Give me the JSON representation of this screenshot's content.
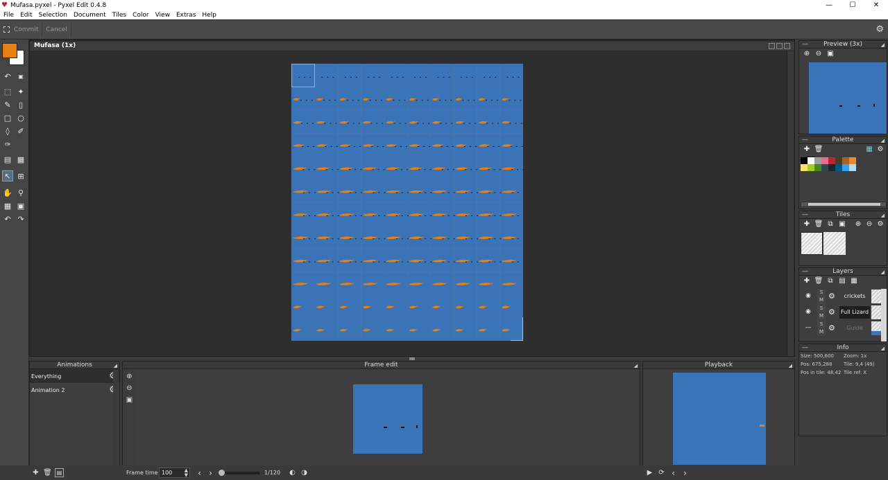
{
  "window": {
    "title": "Mufasa.pyxel - Pyxel Edit 0.4.8",
    "controls": {
      "minimize": "—",
      "maximize": "☐",
      "close": "✕"
    }
  },
  "menu": [
    "File",
    "Edit",
    "Selection",
    "Document",
    "Tiles",
    "Color",
    "View",
    "Extras",
    "Help"
  ],
  "toolbar": {
    "commit_label": "Commit",
    "cancel_label": "Cancel"
  },
  "colors": {
    "primary": "#e87f10",
    "secondary": "#ffffff",
    "canvas_bg": "#3a73b6"
  },
  "canvas": {
    "title": "Mufasa  (1x)"
  },
  "animations": {
    "title": "Animations",
    "items": [
      {
        "label": "Everything",
        "selected": true
      },
      {
        "label": "Animation 2",
        "selected": false
      }
    ]
  },
  "frame_edit": {
    "title": "Frame edit",
    "frame_time_label": "Frame time",
    "frame_time_value": "100",
    "frame_counter": "1/120",
    "frame_position": 0.0
  },
  "playback": {
    "title": "Playback"
  },
  "preview": {
    "title": "Preview (3x)"
  },
  "palette": {
    "title": "Palette",
    "swatches": [
      "#000000",
      "#ffffff",
      "#9d9d9d",
      "#e06f8b",
      "#be2633",
      "#493c2b",
      "#a46422",
      "#eb8931",
      "#f7e26b",
      "#a3ce27",
      "#44891a",
      "#2f484e",
      "#1b2632",
      "#005784",
      "#31a2f2",
      "#b2dcef"
    ]
  },
  "tiles": {
    "title": "Tiles"
  },
  "layers": {
    "title": "Layers",
    "items": [
      {
        "name": "crickets",
        "visible": true,
        "active": false
      },
      {
        "name": "Full Lizard",
        "visible": true,
        "active": true
      },
      {
        "name": "Guide",
        "visible": false,
        "active": false
      }
    ],
    "solo_label": "S",
    "mute_label": "M"
  },
  "info": {
    "title": "Info",
    "size": "Size: 500,600",
    "zoom": "Zoom: 1x",
    "pos": "Pos: 675,288",
    "tile": "Tile: 9,4 (49)",
    "pos_in_tile": "Pos in tile: 48,42",
    "tile_ref": "Tile ref: X"
  }
}
